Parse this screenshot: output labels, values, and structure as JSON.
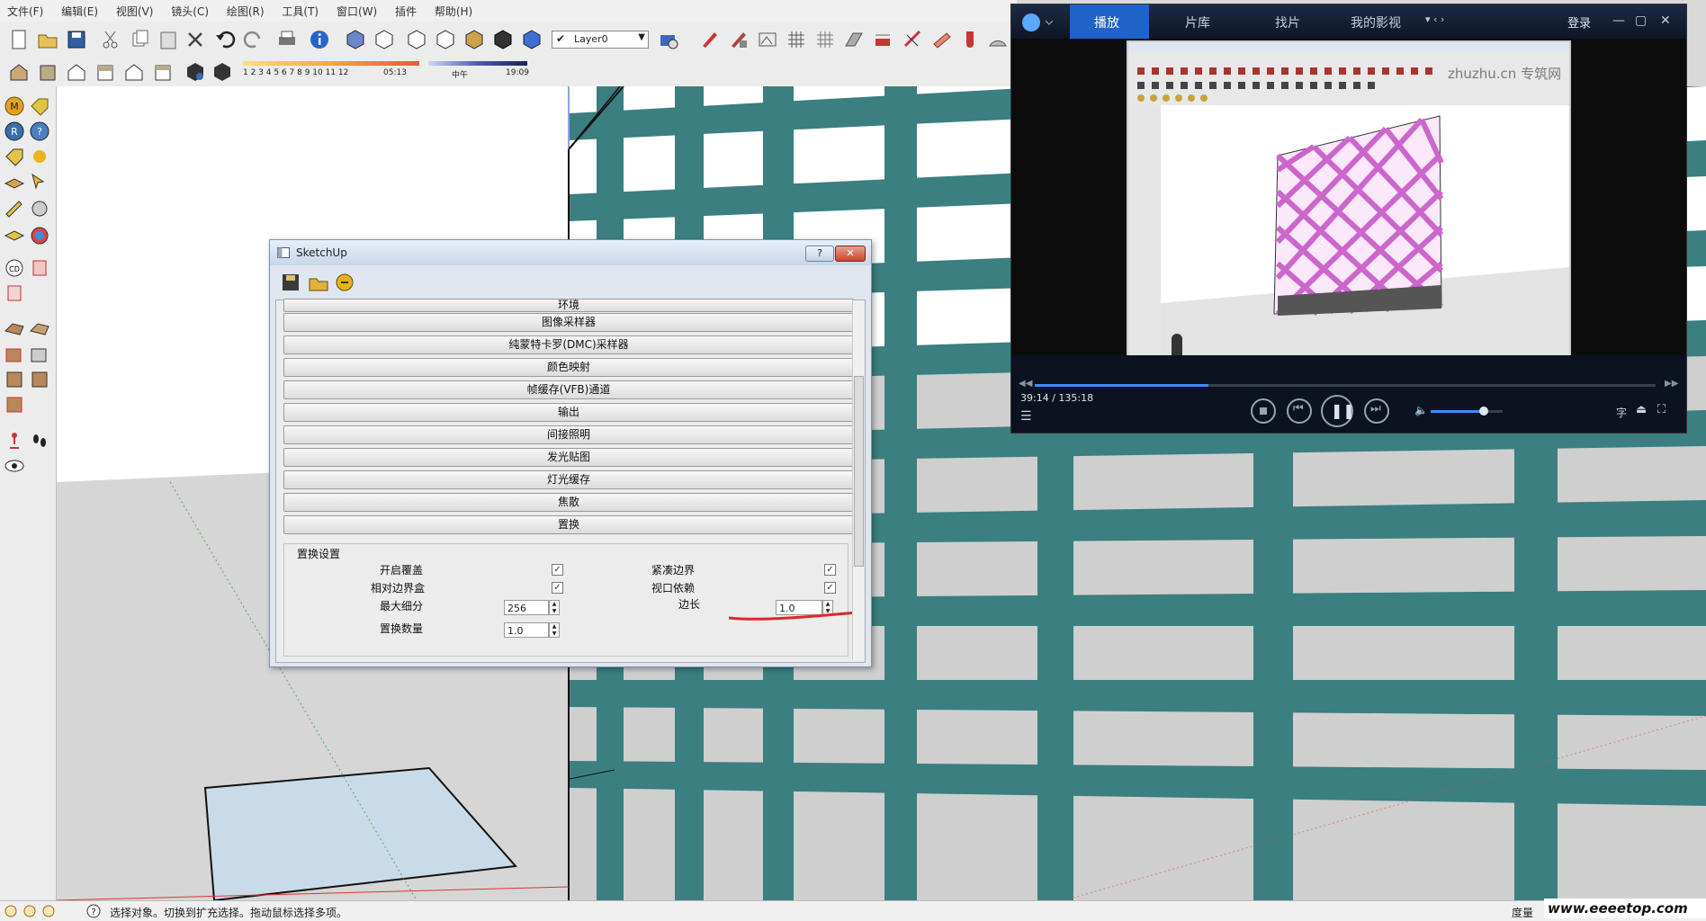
{
  "menubar": {
    "items": [
      "文件(F)",
      "编辑(E)",
      "视图(V)",
      "镜头(C)",
      "绘图(R)",
      "工具(T)",
      "窗口(W)",
      "插件",
      "帮助(H)"
    ]
  },
  "toolbar": {
    "layer_value": "Layer0",
    "shadow_scale": "1 2 3 4 5 6 7 8 9 10 11 12",
    "time_start": "05:13",
    "time_noon": "中午",
    "time_end": "19:09"
  },
  "dialog": {
    "title": "SketchUp",
    "help_button": "?",
    "close_button": "✕",
    "sections": [
      "环境",
      "图像采样器",
      "纯蒙特卡罗(DMC)采样器",
      "颜色映射",
      "帧缓存(VFB)通道",
      "输出",
      "间接照明",
      "发光贴图",
      "灯光缓存",
      "焦散",
      "置换"
    ],
    "group": {
      "title": "置换设置",
      "open_override_label": "开启覆盖",
      "open_override_checked": true,
      "relative_bbox_label": "相对边界盒",
      "relative_bbox_checked": true,
      "max_subdiv_label": "最大细分",
      "max_subdiv_value": "256",
      "amount_label": "置换数量",
      "amount_value": "1.0",
      "tight_bounds_label": "紧凑边界",
      "tight_bounds_checked": true,
      "view_dependent_label": "视口依赖",
      "view_dependent_checked": true,
      "edge_length_label": "边长",
      "edge_length_value": "1.0"
    }
  },
  "player": {
    "tabs": [
      "播放",
      "片库",
      "找片",
      "我的影视"
    ],
    "active_tab": "播放",
    "login": "登录",
    "time": "39:14 / 135:18",
    "subtitle_btn": "字",
    "progress": 0.28,
    "volume": 0.72,
    "watermark": "zhuzhu.cn 专筑网"
  },
  "status": {
    "message": "选择对象。切换到扩充选择。拖动鼠标选择多项。",
    "measure_label": "度量",
    "site": "www.eeeetop.com"
  },
  "colors": {
    "teal": "#3b7f80",
    "pink": "#cc66cc",
    "accent_tab": "#1f63c8"
  }
}
